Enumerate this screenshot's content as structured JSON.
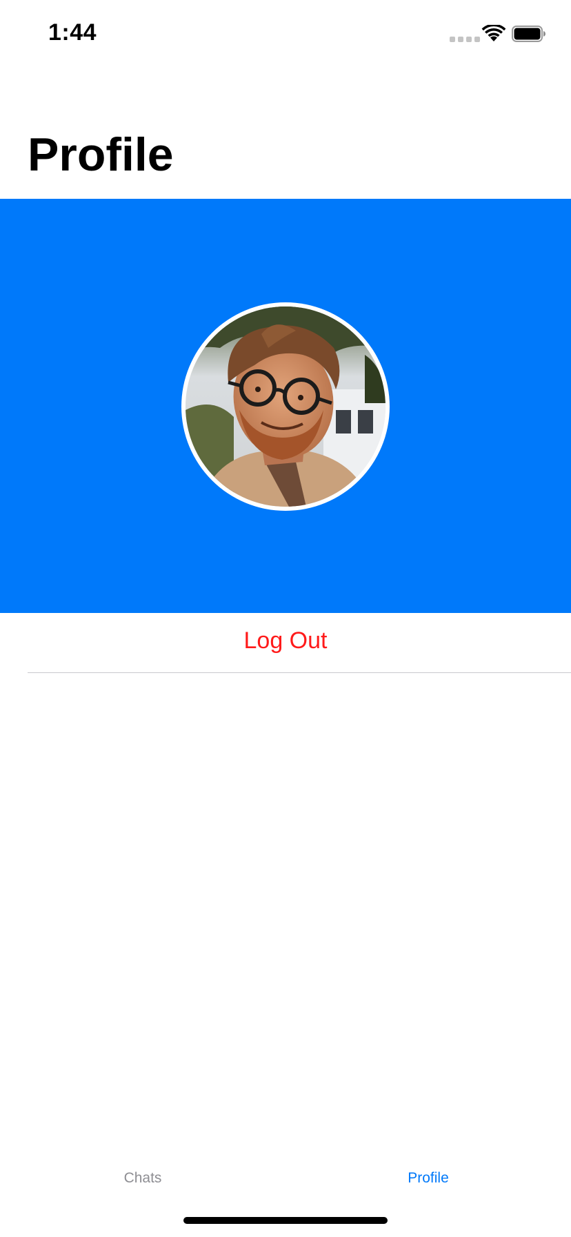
{
  "status_bar": {
    "time": "1:44",
    "icons": [
      "signal-icon",
      "wifi-icon",
      "battery-icon"
    ]
  },
  "page": {
    "title": "Profile"
  },
  "header": {
    "background_color": "#0079fa",
    "avatar": "profile-photo"
  },
  "actions": {
    "logout_label": "Log Out",
    "logout_color": "#ff1a1a"
  },
  "tab_bar": {
    "tabs": [
      {
        "label": "Chats",
        "selected": false
      },
      {
        "label": "Profile",
        "selected": true
      }
    ],
    "active_color": "#0079fa",
    "inactive_color": "#8e8e93"
  }
}
